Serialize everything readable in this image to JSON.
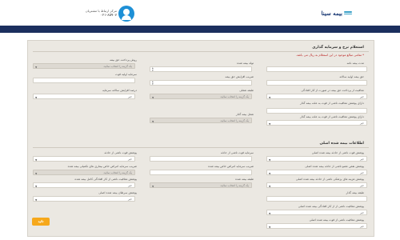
{
  "header": {
    "logo_text": "بیمه سینا",
    "support_label": "مرکز ارتباط با مشتریان",
    "support_phone": "۰۲۱-۸۵۹۰۷"
  },
  "section1": {
    "title": "استعلام نرخ و سرمایه گذاری",
    "note": "* تمامی مبالغ موجود در این استعلام به ریال می باشد.",
    "fields": {
      "insured_birth": {
        "label": "تولد بیمه شده"
      },
      "insurance_duration": {
        "label": "مدت بیمه نامه"
      },
      "payment_method": {
        "label": "روش پرداخت حق بیمه",
        "placeholder": "یک گزینه را انتخاب نمائید."
      },
      "first_premium": {
        "label": "حق بیمه اولیه سالانه"
      },
      "initial_capital": {
        "label": "سرمایه اولیه فوت"
      },
      "coefficient": {
        "label": "ضریب افزایش حق بیمه"
      },
      "premium_increase_rate": {
        "label": "درصد افزایش سالانه حق بیمه",
        "placeholder": "یک گزینه را انتخاب نمائید."
      },
      "capital_increase_rate": {
        "label": "درصد افزایش سالانه سرمایه"
      },
      "insured_job": {
        "label": "شغل بیمه شده"
      },
      "job_class": {
        "label": "طبقه شغلی",
        "placeholder": "یک گزینه را انتخاب نمائید."
      },
      "pay_exemption": {
        "label": "معافیت از پرداخت حق بیمه در صورت از کار افتادگی",
        "value": "خیر"
      },
      "disability_cover": {
        "label": "دارای پوشش معافیت ناشی از فوت به علت بیمه گذار",
        "value": "خیر"
      },
      "policyholder_cover": {
        "label": "دارای پوشش معافیت ناشی از فوت به علت بیمه گذار"
      },
      "policyholder_job": {
        "label": "شغل بیمه گذار",
        "placeholder": "یک گزینه را انتخاب نمائید."
      },
      "exemption_yes": {
        "value": "خیر"
      }
    }
  },
  "section2": {
    "title": "اطلاعات بیمه شده اصلی",
    "fields": {
      "accident_death": {
        "label": "پوشش فوت ناشی از حادثه بیمه شده اصلی",
        "value": "خیر"
      },
      "accident_capital": {
        "label": "سرمایه فوت ناشی از حادثه"
      },
      "accident_death2": {
        "label": "پوشش فوت ناشی از حادثه",
        "value": "خیر"
      },
      "disability_full": {
        "label": "پوشش نقص عضو ناشی از حادثه بیمه شده اصلی",
        "value": "خیر"
      },
      "medical_cost": {
        "label": "ضریب سرمایه امراض خاص بیماری های تکمیلی بیمه شده",
        "placeholder": "یک گزینه را انتخاب نمائید."
      },
      "disease_capital": {
        "label": "ضریب سرمایه امراض خاص بیمه شده"
      },
      "disease_cover": {
        "label": "پوشش هزینه های پزشکی ناشی از حادثه بیمه شده اصلی",
        "value": "خیر"
      },
      "hospital_cover": {
        "label": "پوشش معافیت ناشی از کار افتادگی کامل بیمه شده",
        "value": "خیر"
      },
      "cancer_cover": {
        "label": "پوشش سرطان بیمه شده اصلی",
        "value": "خیر"
      },
      "waiver_cover": {
        "label": "پوشش معافیت ناشی از از کار افتادگی بیمه شده اصلی",
        "value": "خیر"
      },
      "job_class2": {
        "label": "طبقه بیمه شده",
        "placeholder": "یک گزینه را انتخاب نمائید."
      },
      "job_class3": {
        "label": "طبقه بیمه گذار"
      },
      "exemption_death": {
        "label": "پوشش معافیت ناشی از فوت بیمه شده اصلی",
        "value": "خیر"
      }
    }
  },
  "submit_label": "تائید"
}
